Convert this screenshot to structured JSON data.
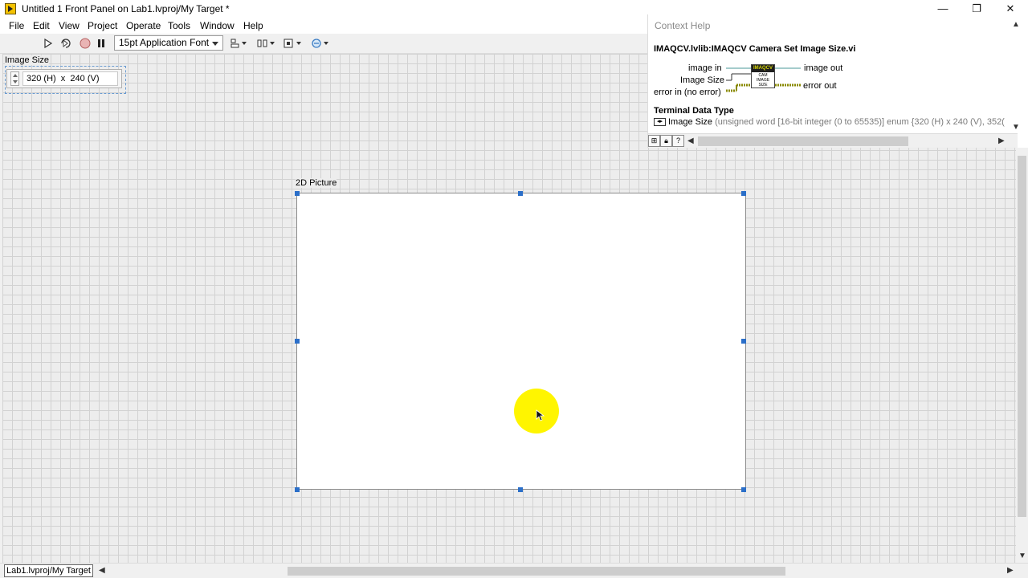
{
  "window": {
    "title": "Untitled 1 Front Panel on Lab1.lvproj/My Target *",
    "controls": {
      "minimize": "—",
      "maximize": "❐",
      "close": "✕"
    }
  },
  "menu": [
    "File",
    "Edit",
    "View",
    "Project",
    "Operate",
    "Tools",
    "Window",
    "Help"
  ],
  "toolbar": {
    "font_select": "15pt Application Font",
    "tools": [
      "run-arrow-icon",
      "run-continuously-icon",
      "abort-icon",
      "pause-icon",
      "align-objects-icon",
      "distribute-objects-icon",
      "resize-objects-icon",
      "reorder-icon"
    ]
  },
  "controls": {
    "image_size": {
      "label": "Image Size",
      "value": "320 (H)  x  240 (V)"
    },
    "picture": {
      "label": "2D Picture"
    }
  },
  "context_help": {
    "title": "Context Help",
    "vi_name": "IMAQCV.lvlib:IMAQCV Camera Set Image Size.vi",
    "terminals": {
      "image_in": "image in",
      "image_size": "Image Size",
      "error_in": "error in (no error)",
      "image_out": "image out",
      "error_out": "error out"
    },
    "icon_top": "IMAQCV",
    "icon_body": "CAM IMAGE SIZE",
    "data_type_heading": "Terminal Data Type",
    "data_type_name": "Image Size",
    "data_type_desc": "(unsigned word [16-bit integer (0 to 65535)] enum {320 (H)  x  240 (V), 352("
  },
  "status": {
    "target": "Lab1.lvproj/My Target"
  },
  "colors": {
    "selection_handles": "#2b6fc9",
    "cursor_highlight": "#fff500",
    "grid": "#d2d2d2"
  }
}
